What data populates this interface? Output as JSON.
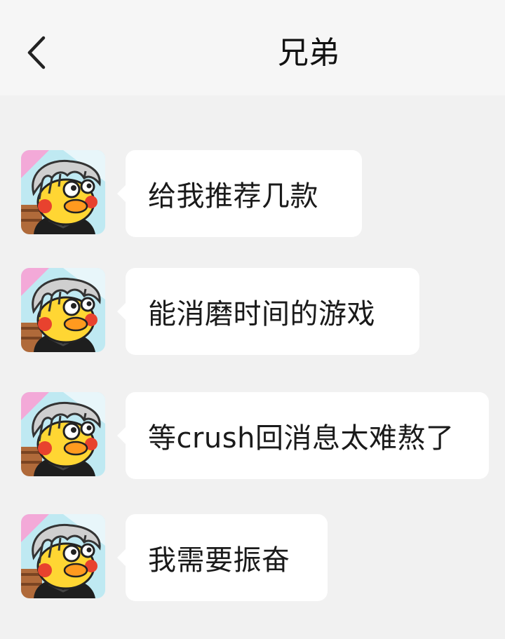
{
  "header": {
    "title": "兄弟",
    "back_icon": "chevron-left-icon"
  },
  "messages": [
    {
      "sender": "other",
      "avatar_icon": "cartoon-duck-avatar",
      "text": "给我推荐几款"
    },
    {
      "sender": "other",
      "avatar_icon": "cartoon-duck-avatar",
      "text": "能消磨时间的游戏"
    },
    {
      "sender": "other",
      "avatar_icon": "cartoon-duck-avatar",
      "text": "等crush回消息太难熬了"
    },
    {
      "sender": "other",
      "avatar_icon": "cartoon-duck-avatar",
      "text": "我需要振奋"
    }
  ],
  "colors": {
    "background": "#f1f1f1",
    "header_background": "#f6f6f6",
    "bubble": "#ffffff",
    "text": "#1a1a1a"
  }
}
